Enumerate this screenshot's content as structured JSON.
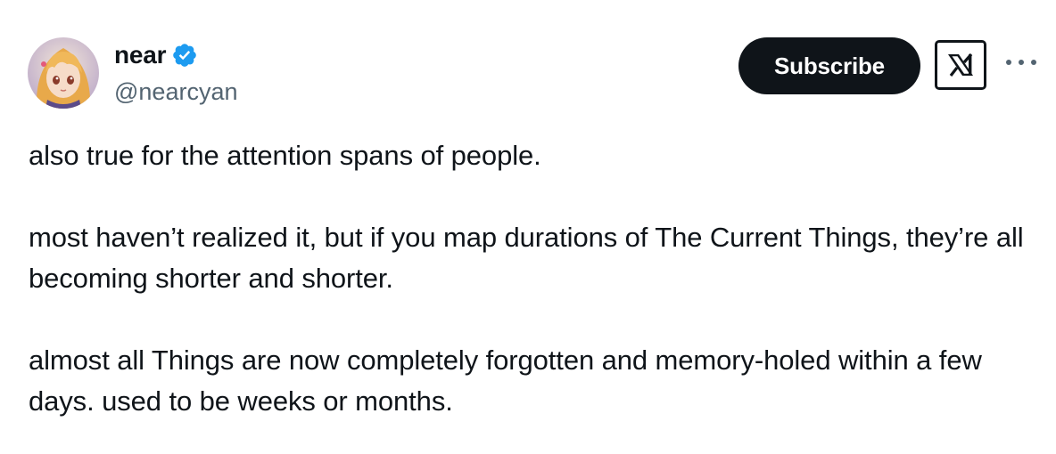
{
  "author": {
    "display_name": "near",
    "handle": "@nearcyan",
    "verified": true,
    "avatar_icon": "anime-avatar-icon"
  },
  "actions": {
    "subscribe_label": "Subscribe",
    "grok_icon": "x-logo-icon",
    "more_icon": "more-options-icon"
  },
  "tweet": {
    "paragraphs": [
      "also true for the attention spans of people.",
      "most haven’t realized it, but if you map durations of The Current Things, they’re all becoming shorter and shorter.",
      "almost all Things are now completely forgotten and memory-holed within a few days. used to be weeks or months."
    ]
  },
  "colors": {
    "text_primary": "#0f1419",
    "text_secondary": "#536471",
    "verified_blue": "#1d9bf0",
    "button_bg": "#0f1419",
    "button_text": "#ffffff"
  }
}
